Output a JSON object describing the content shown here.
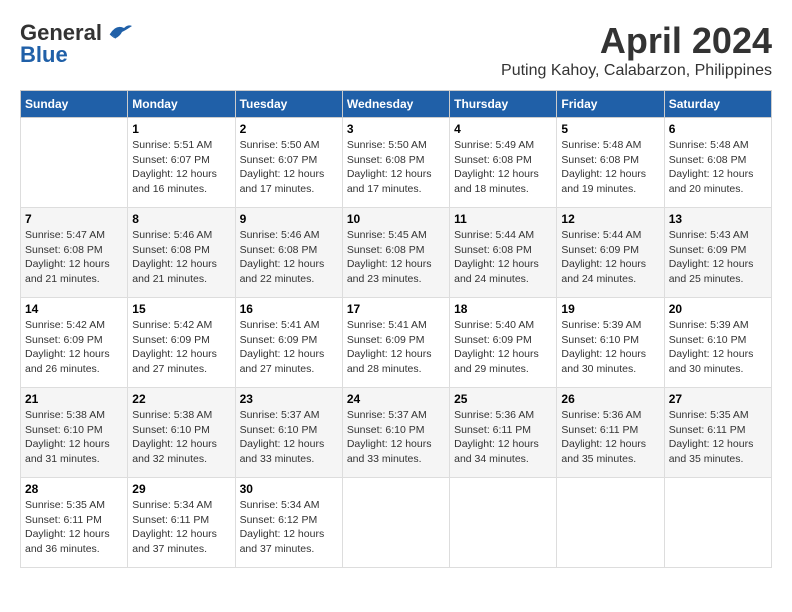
{
  "header": {
    "logo_line1": "General",
    "logo_line2": "Blue",
    "title": "April 2024",
    "subtitle": "Puting Kahoy, Calabarzon, Philippines"
  },
  "calendar": {
    "days_of_week": [
      "Sunday",
      "Monday",
      "Tuesday",
      "Wednesday",
      "Thursday",
      "Friday",
      "Saturday"
    ],
    "weeks": [
      [
        {
          "day": "",
          "info": ""
        },
        {
          "day": "1",
          "info": "Sunrise: 5:51 AM\nSunset: 6:07 PM\nDaylight: 12 hours\nand 16 minutes."
        },
        {
          "day": "2",
          "info": "Sunrise: 5:50 AM\nSunset: 6:07 PM\nDaylight: 12 hours\nand 17 minutes."
        },
        {
          "day": "3",
          "info": "Sunrise: 5:50 AM\nSunset: 6:08 PM\nDaylight: 12 hours\nand 17 minutes."
        },
        {
          "day": "4",
          "info": "Sunrise: 5:49 AM\nSunset: 6:08 PM\nDaylight: 12 hours\nand 18 minutes."
        },
        {
          "day": "5",
          "info": "Sunrise: 5:48 AM\nSunset: 6:08 PM\nDaylight: 12 hours\nand 19 minutes."
        },
        {
          "day": "6",
          "info": "Sunrise: 5:48 AM\nSunset: 6:08 PM\nDaylight: 12 hours\nand 20 minutes."
        }
      ],
      [
        {
          "day": "7",
          "info": "Sunrise: 5:47 AM\nSunset: 6:08 PM\nDaylight: 12 hours\nand 21 minutes."
        },
        {
          "day": "8",
          "info": "Sunrise: 5:46 AM\nSunset: 6:08 PM\nDaylight: 12 hours\nand 21 minutes."
        },
        {
          "day": "9",
          "info": "Sunrise: 5:46 AM\nSunset: 6:08 PM\nDaylight: 12 hours\nand 22 minutes."
        },
        {
          "day": "10",
          "info": "Sunrise: 5:45 AM\nSunset: 6:08 PM\nDaylight: 12 hours\nand 23 minutes."
        },
        {
          "day": "11",
          "info": "Sunrise: 5:44 AM\nSunset: 6:08 PM\nDaylight: 12 hours\nand 24 minutes."
        },
        {
          "day": "12",
          "info": "Sunrise: 5:44 AM\nSunset: 6:09 PM\nDaylight: 12 hours\nand 24 minutes."
        },
        {
          "day": "13",
          "info": "Sunrise: 5:43 AM\nSunset: 6:09 PM\nDaylight: 12 hours\nand 25 minutes."
        }
      ],
      [
        {
          "day": "14",
          "info": "Sunrise: 5:42 AM\nSunset: 6:09 PM\nDaylight: 12 hours\nand 26 minutes."
        },
        {
          "day": "15",
          "info": "Sunrise: 5:42 AM\nSunset: 6:09 PM\nDaylight: 12 hours\nand 27 minutes."
        },
        {
          "day": "16",
          "info": "Sunrise: 5:41 AM\nSunset: 6:09 PM\nDaylight: 12 hours\nand 27 minutes."
        },
        {
          "day": "17",
          "info": "Sunrise: 5:41 AM\nSunset: 6:09 PM\nDaylight: 12 hours\nand 28 minutes."
        },
        {
          "day": "18",
          "info": "Sunrise: 5:40 AM\nSunset: 6:09 PM\nDaylight: 12 hours\nand 29 minutes."
        },
        {
          "day": "19",
          "info": "Sunrise: 5:39 AM\nSunset: 6:10 PM\nDaylight: 12 hours\nand 30 minutes."
        },
        {
          "day": "20",
          "info": "Sunrise: 5:39 AM\nSunset: 6:10 PM\nDaylight: 12 hours\nand 30 minutes."
        }
      ],
      [
        {
          "day": "21",
          "info": "Sunrise: 5:38 AM\nSunset: 6:10 PM\nDaylight: 12 hours\nand 31 minutes."
        },
        {
          "day": "22",
          "info": "Sunrise: 5:38 AM\nSunset: 6:10 PM\nDaylight: 12 hours\nand 32 minutes."
        },
        {
          "day": "23",
          "info": "Sunrise: 5:37 AM\nSunset: 6:10 PM\nDaylight: 12 hours\nand 33 minutes."
        },
        {
          "day": "24",
          "info": "Sunrise: 5:37 AM\nSunset: 6:10 PM\nDaylight: 12 hours\nand 33 minutes."
        },
        {
          "day": "25",
          "info": "Sunrise: 5:36 AM\nSunset: 6:11 PM\nDaylight: 12 hours\nand 34 minutes."
        },
        {
          "day": "26",
          "info": "Sunrise: 5:36 AM\nSunset: 6:11 PM\nDaylight: 12 hours\nand 35 minutes."
        },
        {
          "day": "27",
          "info": "Sunrise: 5:35 AM\nSunset: 6:11 PM\nDaylight: 12 hours\nand 35 minutes."
        }
      ],
      [
        {
          "day": "28",
          "info": "Sunrise: 5:35 AM\nSunset: 6:11 PM\nDaylight: 12 hours\nand 36 minutes."
        },
        {
          "day": "29",
          "info": "Sunrise: 5:34 AM\nSunset: 6:11 PM\nDaylight: 12 hours\nand 37 minutes."
        },
        {
          "day": "30",
          "info": "Sunrise: 5:34 AM\nSunset: 6:12 PM\nDaylight: 12 hours\nand 37 minutes."
        },
        {
          "day": "",
          "info": ""
        },
        {
          "day": "",
          "info": ""
        },
        {
          "day": "",
          "info": ""
        },
        {
          "day": "",
          "info": ""
        }
      ]
    ]
  }
}
